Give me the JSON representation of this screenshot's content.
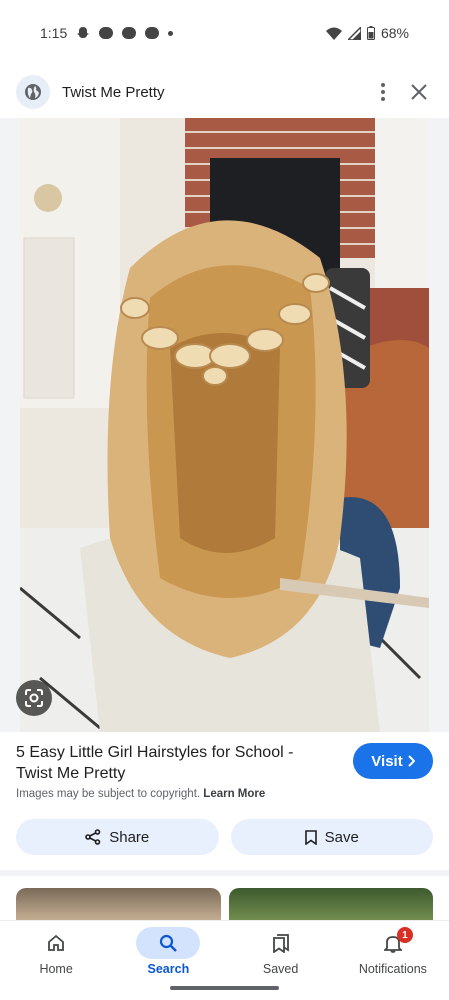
{
  "status_bar": {
    "time": "1:15",
    "battery": "68%"
  },
  "header": {
    "site_name": "Twist Me Pretty"
  },
  "result": {
    "title": "5 Easy Little Girl Hairstyles for School - Twist Me Pretty",
    "visit_label": "Visit",
    "copyright_text": "Images may be subject to copyright.",
    "learn_more": "Learn More"
  },
  "actions": {
    "share_label": "Share",
    "save_label": "Save"
  },
  "bottom_nav": {
    "items": [
      {
        "label": "Home",
        "icon": "home-icon"
      },
      {
        "label": "Search",
        "icon": "search-icon"
      },
      {
        "label": "Saved",
        "icon": "bookmarks-icon"
      },
      {
        "label": "Notifications",
        "icon": "bell-icon"
      }
    ],
    "active": "Search",
    "notification_count": "1"
  },
  "colors": {
    "accent": "#1a73e8",
    "active_nav": "#0b57d0",
    "chip_bg": "#e8f0fe",
    "badge": "#d93025"
  }
}
